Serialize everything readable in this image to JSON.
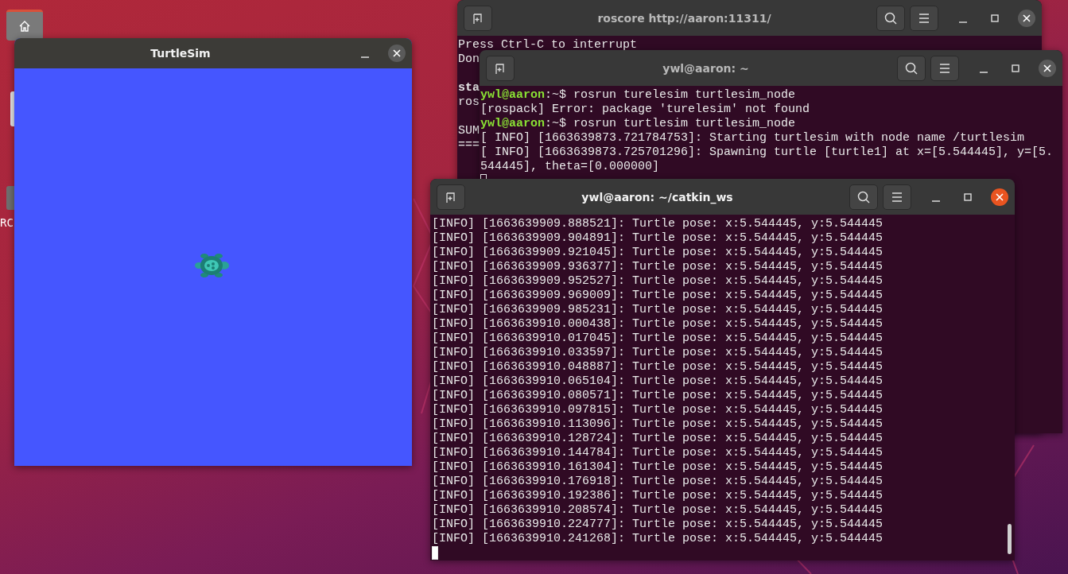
{
  "desktop": {
    "labels": [
      "RC"
    ]
  },
  "windows": [
    {
      "kind": "terminal",
      "title": "roscore http://aaron:11311/",
      "focused": false,
      "lines": [
        {
          "kind": "text",
          "text": "Press Ctrl-C to interrupt"
        },
        {
          "kind": "text",
          "text": "Don"
        },
        {
          "kind": "blank"
        },
        {
          "kind": "bold",
          "text": "sta"
        },
        {
          "kind": "text",
          "text": "ros"
        },
        {
          "kind": "blank"
        },
        {
          "kind": "text",
          "text": "SUM"
        },
        {
          "kind": "text",
          "text": "==="
        }
      ]
    },
    {
      "kind": "terminal",
      "title": "ywl@aaron: ~",
      "focused": false,
      "lines": [
        {
          "kind": "prompt",
          "user": "ywl@aaron",
          "text": ":~$ rosrun turelesim turtlesim_node"
        },
        {
          "kind": "text",
          "text": "[rospack] Error: package 'turelesim' not found"
        },
        {
          "kind": "prompt",
          "user": "ywl@aaron",
          "text": ":~$ rosrun turtlesim turtlesim_node"
        },
        {
          "kind": "text",
          "text": "[ INFO] [1663639873.721784753]: Starting turtlesim with node name /turtlesim"
        },
        {
          "kind": "text",
          "text": "[ INFO] [1663639873.725701296]: Spawning turtle [turtle1] at x=[5.544445], y=[5.544445], theta=[0.000000]"
        },
        {
          "kind": "cursor"
        }
      ]
    },
    {
      "kind": "turtlesim",
      "title": "TurtleSim",
      "focused": false
    },
    {
      "kind": "terminal",
      "title": "ywl@aaron: ~/catkin_ws",
      "focused": true,
      "lines": [
        {
          "kind": "text",
          "text": "[INFO] [1663639909.888521]: Turtle pose: x:5.544445, y:5.544445"
        },
        {
          "kind": "text",
          "text": "[INFO] [1663639909.904891]: Turtle pose: x:5.544445, y:5.544445"
        },
        {
          "kind": "text",
          "text": "[INFO] [1663639909.921045]: Turtle pose: x:5.544445, y:5.544445"
        },
        {
          "kind": "text",
          "text": "[INFO] [1663639909.936377]: Turtle pose: x:5.544445, y:5.544445"
        },
        {
          "kind": "text",
          "text": "[INFO] [1663639909.952527]: Turtle pose: x:5.544445, y:5.544445"
        },
        {
          "kind": "text",
          "text": "[INFO] [1663639909.969009]: Turtle pose: x:5.544445, y:5.544445"
        },
        {
          "kind": "text",
          "text": "[INFO] [1663639909.985231]: Turtle pose: x:5.544445, y:5.544445"
        },
        {
          "kind": "text",
          "text": "[INFO] [1663639910.000438]: Turtle pose: x:5.544445, y:5.544445"
        },
        {
          "kind": "text",
          "text": "[INFO] [1663639910.017045]: Turtle pose: x:5.544445, y:5.544445"
        },
        {
          "kind": "text",
          "text": "[INFO] [1663639910.033597]: Turtle pose: x:5.544445, y:5.544445"
        },
        {
          "kind": "text",
          "text": "[INFO] [1663639910.048887]: Turtle pose: x:5.544445, y:5.544445"
        },
        {
          "kind": "text",
          "text": "[INFO] [1663639910.065104]: Turtle pose: x:5.544445, y:5.544445"
        },
        {
          "kind": "text",
          "text": "[INFO] [1663639910.080571]: Turtle pose: x:5.544445, y:5.544445"
        },
        {
          "kind": "text",
          "text": "[INFO] [1663639910.097815]: Turtle pose: x:5.544445, y:5.544445"
        },
        {
          "kind": "text",
          "text": "[INFO] [1663639910.113096]: Turtle pose: x:5.544445, y:5.544445"
        },
        {
          "kind": "text",
          "text": "[INFO] [1663639910.128724]: Turtle pose: x:5.544445, y:5.544445"
        },
        {
          "kind": "text",
          "text": "[INFO] [1663639910.144784]: Turtle pose: x:5.544445, y:5.544445"
        },
        {
          "kind": "text",
          "text": "[INFO] [1663639910.161304]: Turtle pose: x:5.544445, y:5.544445"
        },
        {
          "kind": "text",
          "text": "[INFO] [1663639910.176918]: Turtle pose: x:5.544445, y:5.544445"
        },
        {
          "kind": "text",
          "text": "[INFO] [1663639910.192386]: Turtle pose: x:5.544445, y:5.544445"
        },
        {
          "kind": "text",
          "text": "[INFO] [1663639910.208574]: Turtle pose: x:5.544445, y:5.544445"
        },
        {
          "kind": "text",
          "text": "[INFO] [1663639910.224777]: Turtle pose: x:5.544445, y:5.544445"
        },
        {
          "kind": "text",
          "text": "[INFO] [1663639910.241268]: Turtle pose: x:5.544445, y:5.544445"
        },
        {
          "kind": "cursor"
        }
      ]
    }
  ]
}
